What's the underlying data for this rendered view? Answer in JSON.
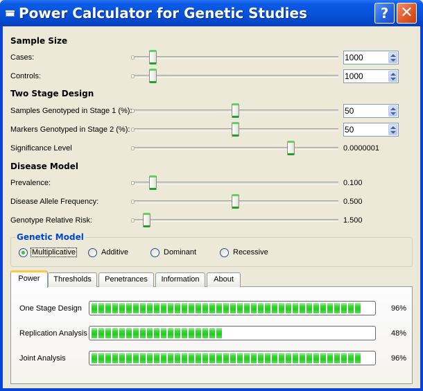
{
  "window": {
    "title": "Power Calculator for Genetic Studies",
    "help_button": "?",
    "close_button": "✕"
  },
  "sample_size": {
    "heading": "Sample Size",
    "cases": {
      "label": "Cases:",
      "value": "1000",
      "slider_level": 0.1
    },
    "controls": {
      "label": "Controls:",
      "value": "1000",
      "slider_level": 0.1
    }
  },
  "two_stage": {
    "heading": "Two Stage Design",
    "samples_stage1": {
      "label": "Samples Genotyped in Stage 1 (%):",
      "value": "50",
      "slider_level": 0.5
    },
    "markers_stage2": {
      "label": "Markers Genotyped in Stage 2 (%):",
      "value": "50",
      "slider_level": 0.5
    },
    "significance": {
      "label": "Significance Level",
      "value": "0.0000001",
      "slider_level": 0.77
    }
  },
  "disease_model": {
    "heading": "Disease Model",
    "prevalence": {
      "label": "Prevalence:",
      "value": "0.100",
      "slider_level": 0.1
    },
    "allele_freq": {
      "label": "Disease Allele Frequency:",
      "value": "0.500",
      "slider_level": 0.5
    },
    "relative_risk": {
      "label": "Genotype Relative Risk:",
      "value": "1.500",
      "slider_level": 0.07
    }
  },
  "genetic_model": {
    "heading": "Genetic Model",
    "options": [
      {
        "label": "Multiplicative",
        "checked": true
      },
      {
        "label": "Additive",
        "checked": false
      },
      {
        "label": "Dominant",
        "checked": false
      },
      {
        "label": "Recessive",
        "checked": false
      }
    ]
  },
  "tabs": [
    {
      "label": "Power",
      "active": true
    },
    {
      "label": "Thresholds",
      "active": false
    },
    {
      "label": "Penetrances",
      "active": false
    },
    {
      "label": "Information",
      "active": false
    },
    {
      "label": "About",
      "active": false
    }
  ],
  "power": {
    "rows": [
      {
        "label": "One Stage Design",
        "percent": 96,
        "percent_text": "96%"
      },
      {
        "label": "Replication Analysis",
        "percent": 48,
        "percent_text": "48%"
      },
      {
        "label": "Joint Analysis",
        "percent": 96,
        "percent_text": "96%"
      }
    ]
  }
}
